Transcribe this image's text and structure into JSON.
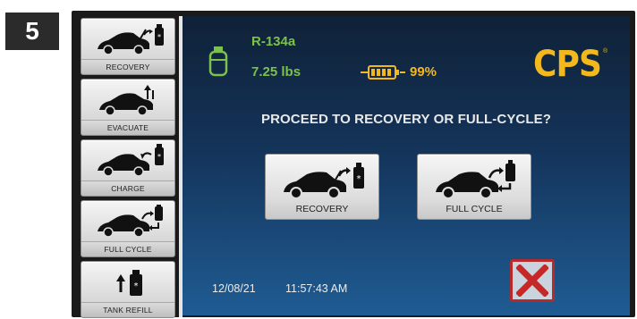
{
  "step_number": "5",
  "sidebar": {
    "items": [
      {
        "label": "RECOVERY",
        "icon": "car-to-tank-icon"
      },
      {
        "label": "EVACUATE",
        "icon": "car-evacuate-icon"
      },
      {
        "label": "CHARGE",
        "icon": "tank-to-car-icon"
      },
      {
        "label": "FULL CYCLE",
        "icon": "car-full-cycle-icon"
      },
      {
        "label": "TANK REFILL",
        "icon": "tank-refill-icon"
      }
    ]
  },
  "status": {
    "refrigerant": "R-134a",
    "weight": "7.25 lbs",
    "battery_percent": "99%"
  },
  "brand": {
    "logo_text": "CPS",
    "mark": "®"
  },
  "prompt": "PROCEED TO RECOVERY OR FULL-CYCLE?",
  "actions": {
    "recovery_label": "RECOVERY",
    "full_cycle_label": "FULL CYCLE"
  },
  "footer": {
    "date": "12/08/21",
    "time": "11:57:43 AM"
  },
  "colors": {
    "status_green": "#7cc04d",
    "accent_gold": "#f2b81c",
    "cancel_red": "#c62828"
  }
}
